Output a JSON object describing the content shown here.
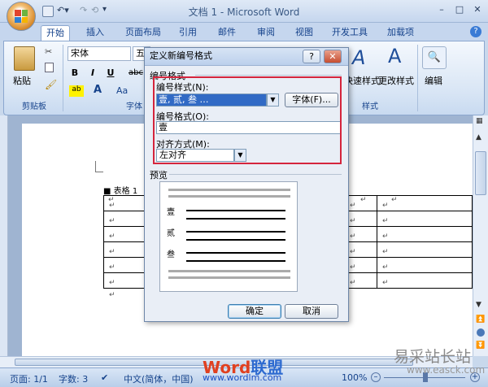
{
  "window": {
    "title": "文档 1 - Microsoft Word",
    "minimize": "–",
    "maximize": "□",
    "close": "✕"
  },
  "tabs": [
    "开始",
    "插入",
    "页面布局",
    "引用",
    "邮件",
    "审阅",
    "视图",
    "开发工具",
    "加载项"
  ],
  "ribbon": {
    "paste_label": "粘贴",
    "clipboard_group": "剪贴板",
    "font_name": "宋体",
    "font_size": "五",
    "font_group": "字体",
    "bold": "B",
    "italic": "I",
    "underline": "U",
    "strike": "abc",
    "quick_styles": "快速样式",
    "change_styles": "更改样式",
    "styles_group": "样式",
    "editing": "编辑"
  },
  "document": {
    "table_caption": "表格 1",
    "para_mark": "↵",
    "rows": 6
  },
  "dialog": {
    "title": "定义新编号格式",
    "help": "?",
    "close": "✕",
    "section_format": "编号格式",
    "number_style_label": "编号样式(N):",
    "number_style_value": "壹, 贰, 叁 …",
    "font_button": "字体(F)...",
    "number_format_label": "编号格式(O):",
    "number_format_value": "壹",
    "alignment_label": "对齐方式(M):",
    "alignment_value": "左对齐",
    "preview_label": "预览",
    "preview_items": [
      "壹",
      "贰",
      "叁"
    ],
    "ok": "确定",
    "cancel": "取消"
  },
  "statusbar": {
    "page": "页面: 1/1",
    "words": "字数: 3",
    "language": "中文(简体，中国)",
    "zoom": "100%"
  },
  "watermarks": {
    "wordlm_a": "Word",
    "wordlm_b": "联盟",
    "wordlm_url": "www.wordlm.com",
    "easck": "易采站长站",
    "easck_url": "www.easck.com"
  }
}
